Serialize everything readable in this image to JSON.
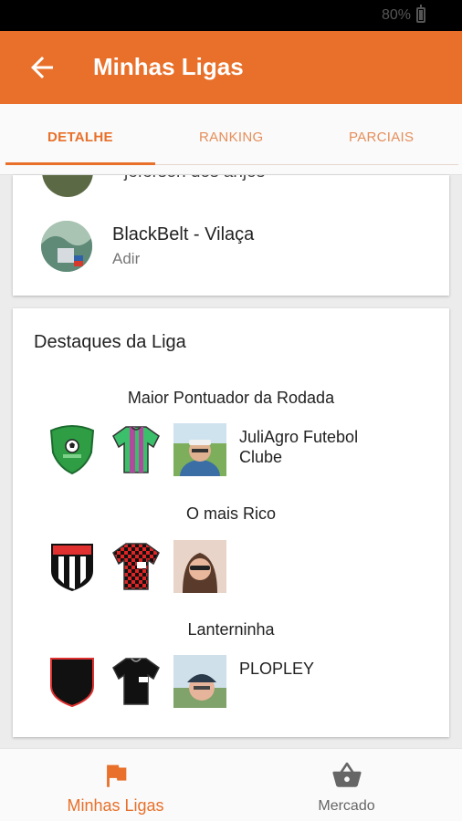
{
  "status_bar": {
    "battery_text": "80%"
  },
  "app_bar": {
    "title": "Minhas Ligas"
  },
  "tabs": [
    {
      "label": "DETALHE"
    },
    {
      "label": "RANKING"
    },
    {
      "label": "PARCIAIS"
    }
  ],
  "members": {
    "partial_name": "jeferson dos anjos",
    "item": {
      "team": "BlackBelt - Vilaça",
      "owner": "Adir"
    }
  },
  "highlights": {
    "title": "Destaques da Liga",
    "items": [
      {
        "label": "Maior Pontuador da Rodada",
        "team_name": "JuliAgro Futebol Clube"
      },
      {
        "label": "O mais Rico",
        "team_name": ""
      },
      {
        "label": "Lanterninha",
        "team_name": "PLOPLEY"
      }
    ]
  },
  "bottom_nav": {
    "items": [
      {
        "label": "Minhas Ligas"
      },
      {
        "label": "Mercado"
      }
    ]
  },
  "colors": {
    "accent": "#e8702a"
  }
}
